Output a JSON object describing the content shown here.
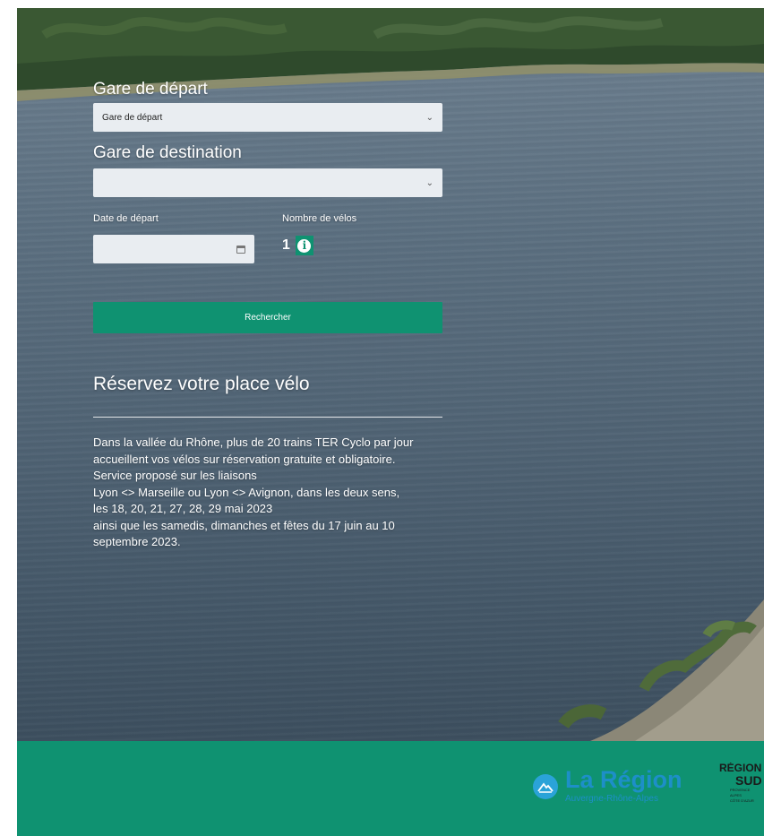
{
  "form": {
    "departure": {
      "label": "Gare de départ",
      "selected": "Gare de départ"
    },
    "destination": {
      "label": "Gare de destination",
      "selected": ""
    },
    "date": {
      "label": "Date de départ",
      "value": ""
    },
    "bikes": {
      "label": "Nombre de vélos",
      "value": "1"
    },
    "search_button": "Rechercher"
  },
  "info": {
    "title": "Réservez votre place vélo",
    "lines": [
      "Dans la vallée du Rhône, plus de 20 trains TER Cyclo par jour",
      "accueillent vos vélos sur réservation gratuite et obligatoire.",
      "Service proposé sur les liaisons",
      "Lyon <> Marseille ou Lyon <> Avignon, dans les deux sens,",
      "les 18, 20, 21, 27, 28, 29 mai 2023",
      "ainsi que les samedis, dimanches et fêtes du 17 juin au 10",
      "septembre 2023."
    ]
  },
  "footer": {
    "logo_ara": {
      "title": "La Région",
      "subtitle": "Auvergne-Rhône-Alpes"
    },
    "logo_sud": {
      "line1": "RÉGION",
      "line2": "SUD",
      "line3": "PROVENCE",
      "line4": "ALPES",
      "line5": "CÔTE D'AZUR"
    }
  },
  "colors": {
    "accent_green": "#0f9271",
    "logo_blue": "#1d8fc8"
  },
  "icons": {
    "select_chevron": "chevron-down-icon",
    "calendar": "calendar-icon",
    "info": "info-icon",
    "ara_logo": "mountain-logo-icon"
  }
}
